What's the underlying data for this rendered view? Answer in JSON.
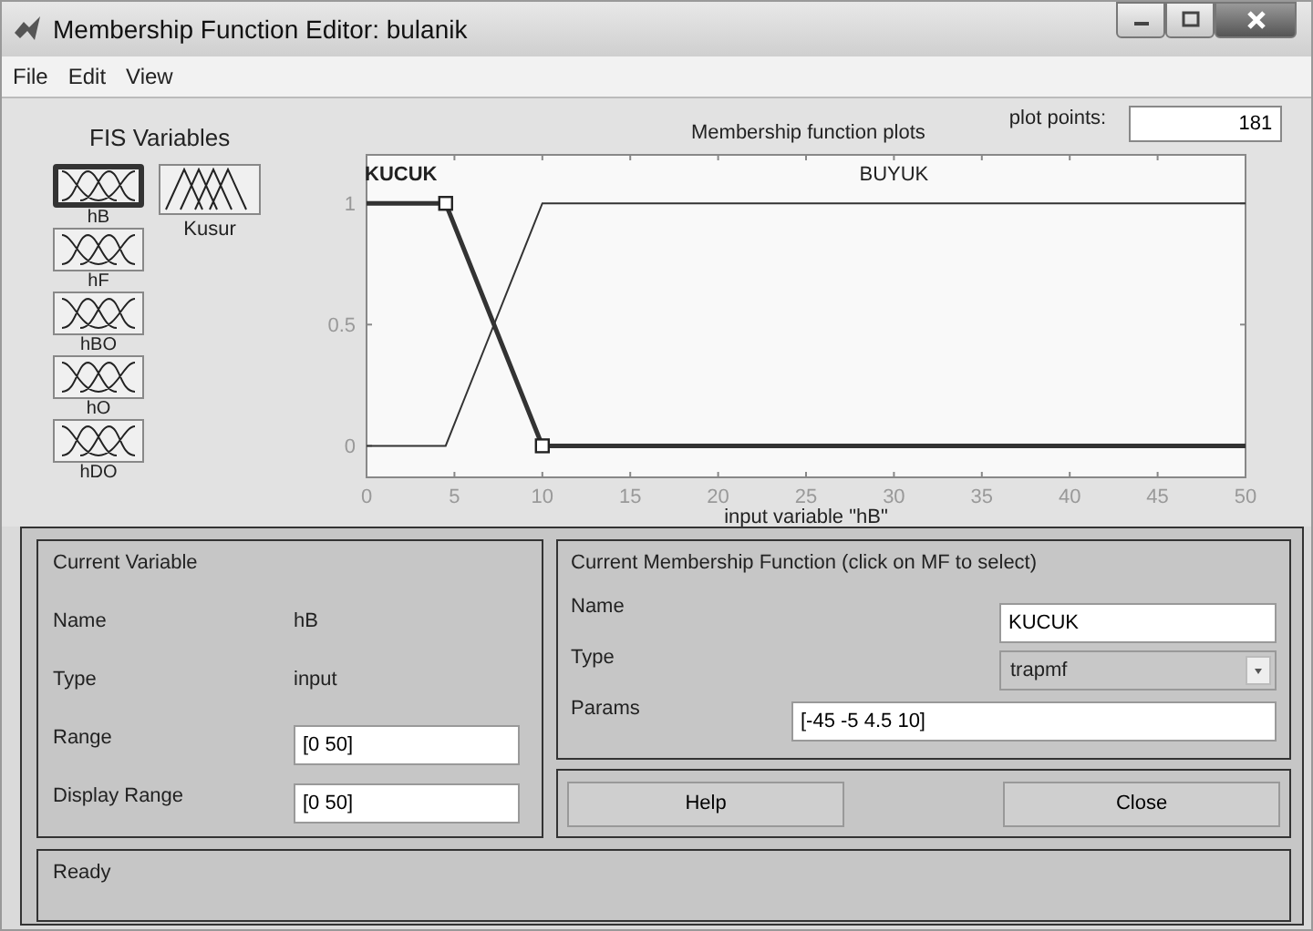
{
  "window": {
    "title": "Membership Function Editor: bulanik"
  },
  "menu": [
    "File",
    "Edit",
    "View"
  ],
  "fis_variables": {
    "title": "FIS Variables",
    "inputs": [
      {
        "name": "hB",
        "selected": true
      },
      {
        "name": "hF",
        "selected": false
      },
      {
        "name": "hBO",
        "selected": false
      },
      {
        "name": "hO",
        "selected": false
      },
      {
        "name": "hDO",
        "selected": false
      }
    ],
    "outputs": [
      {
        "name": "Kusur",
        "selected": false
      }
    ]
  },
  "plot": {
    "title": "Membership function plots",
    "plot_points_label": "plot points:",
    "plot_points": "181",
    "chart_data": {
      "type": "line",
      "xlabel": "input variable \"hB\"",
      "x": [
        0,
        4.5,
        10,
        50
      ],
      "series": [
        {
          "name": "KUCUK",
          "values": [
            1,
            1,
            0,
            0
          ]
        },
        {
          "name": "BUYUK",
          "values": [
            0,
            0,
            1,
            1
          ]
        }
      ],
      "xlim": [
        0,
        50
      ],
      "ylim": [
        -0.13,
        1.2
      ],
      "xticks": [
        0,
        5,
        10,
        15,
        20,
        25,
        30,
        35,
        40,
        45,
        50
      ],
      "yticks": [
        0,
        0.5,
        1
      ]
    },
    "membership_functions": [
      {
        "selected": true
      },
      {
        "selected": false
      }
    ]
  },
  "current_variable": {
    "title": "Current Variable",
    "name_label": "Name",
    "name": "hB",
    "type_label": "Type",
    "type": "input",
    "range_label": "Range",
    "range": "[0 50]",
    "display_range_label": "Display Range",
    "display_range": "[0 50]"
  },
  "current_mf": {
    "title": "Current Membership Function (click on MF to select)",
    "name_label": "Name",
    "name": "KUCUK",
    "type_label": "Type",
    "type": "trapmf",
    "params_label": "Params",
    "params": "[-45 -5 4.5 10]"
  },
  "buttons": [
    "Help",
    "Close"
  ],
  "status": "Ready"
}
